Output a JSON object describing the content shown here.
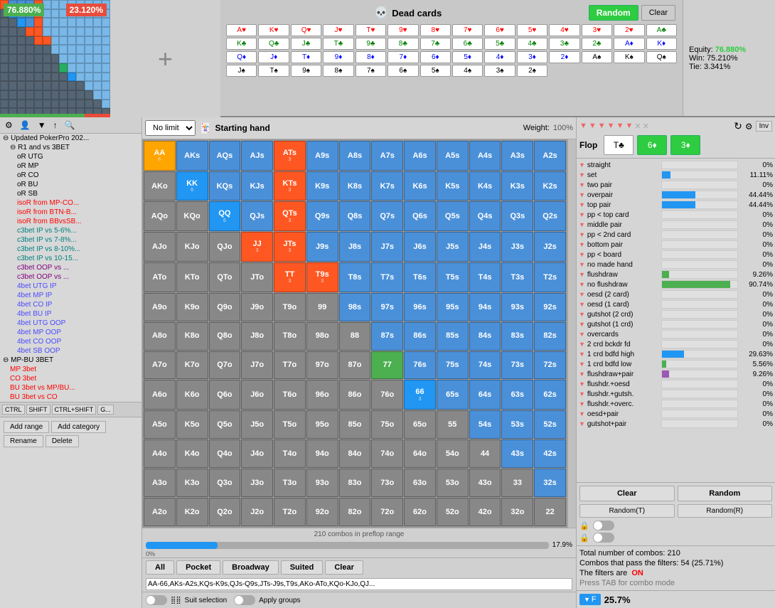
{
  "top": {
    "equity1": "76.880%",
    "equity2": "23.120%",
    "buttons": {
      "random": "Random",
      "clear": "Clear"
    },
    "equity": {
      "label": "Equity:",
      "value": "76.880%",
      "win_label": "Win:",
      "win_value": "75.210%",
      "tie_label": "Tie:",
      "tie_value": "3.341%"
    },
    "dead_cards_title": "Dead cards"
  },
  "sidebar": {
    "toolbar": {
      "icons": [
        "⚙",
        "👤",
        "▼",
        "↑",
        "🔍"
      ]
    },
    "tree": [
      {
        "label": "Updated PokerPro 202...",
        "level": 0,
        "type": "parent",
        "expanded": true
      },
      {
        "label": "R1 and vs 3BET",
        "level": 1,
        "type": "parent",
        "expanded": true
      },
      {
        "label": "oR UTG",
        "level": 2,
        "type": "leaf"
      },
      {
        "label": "oR MP",
        "level": 2,
        "type": "leaf"
      },
      {
        "label": "oR CO",
        "level": 2,
        "type": "leaf"
      },
      {
        "label": "oR BU",
        "level": 2,
        "type": "leaf"
      },
      {
        "label": "oR SB",
        "level": 2,
        "type": "leaf"
      },
      {
        "label": "isoR from MP-CO...",
        "level": 2,
        "type": "leaf",
        "color": "red"
      },
      {
        "label": "isoR from BTN-B...",
        "level": 2,
        "type": "leaf",
        "color": "red"
      },
      {
        "label": "isoR from BBvsSB...",
        "level": 2,
        "type": "leaf",
        "color": "red"
      },
      {
        "label": "c3bet IP vs 5-6%...",
        "level": 2,
        "type": "leaf",
        "color": "teal"
      },
      {
        "label": "c3bet IP vs 7-8%...",
        "level": 2,
        "type": "leaf",
        "color": "teal"
      },
      {
        "label": "c3bet IP vs 8-10%...",
        "level": 2,
        "type": "leaf",
        "color": "teal"
      },
      {
        "label": "c3bet IP vs 10-15...",
        "level": 2,
        "type": "leaf",
        "color": "teal"
      },
      {
        "label": "c3bet OOP vs ...",
        "level": 2,
        "type": "leaf",
        "color": "purple"
      },
      {
        "label": "c3bet OOP vs ...",
        "level": 2,
        "type": "leaf",
        "color": "purple"
      },
      {
        "label": "4bet UTG IP",
        "level": 2,
        "type": "leaf",
        "color": "blue"
      },
      {
        "label": "4bet MP IP",
        "level": 2,
        "type": "leaf",
        "color": "blue"
      },
      {
        "label": "4bet CO IP",
        "level": 2,
        "type": "leaf",
        "color": "blue"
      },
      {
        "label": "4bet BU IP",
        "level": 2,
        "type": "leaf",
        "color": "blue"
      },
      {
        "label": "4bet UTG OOP",
        "level": 2,
        "type": "leaf",
        "color": "blue"
      },
      {
        "label": "4bet MP OOP",
        "level": 2,
        "type": "leaf",
        "color": "blue"
      },
      {
        "label": "4bet CO OOP",
        "level": 2,
        "type": "leaf",
        "color": "blue"
      },
      {
        "label": "4bet SB OOP",
        "level": 2,
        "type": "leaf",
        "color": "blue"
      },
      {
        "label": "MP-BU 3BET",
        "level": 0,
        "type": "parent",
        "expanded": true
      },
      {
        "label": "MP 3bet",
        "level": 1,
        "type": "leaf",
        "color": "red"
      },
      {
        "label": "CO 3bet",
        "level": 1,
        "type": "leaf",
        "color": "red"
      },
      {
        "label": "BU 3bet vs MP/BU...",
        "level": 1,
        "type": "leaf",
        "color": "red"
      },
      {
        "label": "BU 3bet vs CO",
        "level": 1,
        "type": "leaf",
        "color": "red"
      }
    ],
    "bottom_buttons": [
      {
        "label": "Add range"
      },
      {
        "label": "Add category"
      },
      {
        "label": "Rename"
      },
      {
        "label": "Delete"
      }
    ],
    "keyboard_hints": [
      "CTRL",
      "SHIFT",
      "CTRL+SHIFT",
      "G..."
    ]
  },
  "center": {
    "toolbar": {
      "limit_options": [
        "No limit"
      ],
      "limit_selected": "No limit",
      "hand_label": "Starting hand",
      "weight_label": "Weight:",
      "weight_value": "100%"
    },
    "grid": {
      "headers": [
        "A",
        "K",
        "Q",
        "J",
        "T",
        "9",
        "8",
        "7",
        "6",
        "5",
        "4",
        "3",
        "2"
      ],
      "cells": [
        [
          "AA\n6",
          "AKs",
          "AQs",
          "AJs",
          "ATs\n3",
          "A9s",
          "A8s",
          "A7s",
          "A6s",
          "A5s",
          "A4s",
          "A3s",
          "A2s"
        ],
        [
          "AKo",
          "KK\n6",
          "KQs",
          "KJs",
          "KTs\n3",
          "K9s",
          "K8s",
          "K7s",
          "K6s",
          "K5s",
          "K4s",
          "K3s",
          "K2s"
        ],
        [
          "AQo",
          "KQo",
          "QQ\n6",
          "QJs",
          "QTs\n3",
          "Q9s",
          "Q8s",
          "Q7s",
          "Q6s",
          "Q5s",
          "Q4s",
          "Q3s",
          "Q2s"
        ],
        [
          "AJo",
          "KJo",
          "QJo",
          "JJ\n3",
          "JTs\n3",
          "J9s",
          "J8s",
          "J7s",
          "J6s",
          "J5s",
          "J4s",
          "J3s",
          "J2s"
        ],
        [
          "ATo",
          "KTo",
          "QTo",
          "JTo",
          "TT\n3",
          "T9s\n3",
          "T8s",
          "T7s",
          "T6s",
          "T5s",
          "T4s",
          "T3s",
          "T2s"
        ],
        [
          "A9o",
          "K9o",
          "Q9o",
          "J9o",
          "T9o",
          "99",
          "98s",
          "97s",
          "96s",
          "95s",
          "94s",
          "93s",
          "92s"
        ],
        [
          "A8o",
          "K8o",
          "Q8o",
          "J8o",
          "T8o",
          "98o",
          "88",
          "87s",
          "86s",
          "85s",
          "84s",
          "83s",
          "82s"
        ],
        [
          "A7o",
          "K7o",
          "Q7o",
          "J7o",
          "T7o",
          "97o",
          "87o",
          "77",
          "76s",
          "75s",
          "74s",
          "73s",
          "72s"
        ],
        [
          "A6o",
          "K6o",
          "Q6o",
          "J6o",
          "T6o",
          "96o",
          "86o",
          "76o",
          "66\n3",
          "65s",
          "64s",
          "63s",
          "62s"
        ],
        [
          "A5o",
          "K5o",
          "Q5o",
          "J5o",
          "T5o",
          "95o",
          "85o",
          "75o",
          "65o",
          "55",
          "54s",
          "53s",
          "52s"
        ],
        [
          "A4o",
          "K4o",
          "Q4o",
          "J4o",
          "T4o",
          "94o",
          "84o",
          "74o",
          "64o",
          "54o",
          "44",
          "43s",
          "42s"
        ],
        [
          "A3o",
          "K3o",
          "Q3o",
          "J3o",
          "T3o",
          "93o",
          "83o",
          "73o",
          "63o",
          "53o",
          "43o",
          "33",
          "32s"
        ],
        [
          "A2o",
          "K2o",
          "Q2o",
          "J2o",
          "T2o",
          "92o",
          "82o",
          "72o",
          "62o",
          "52o",
          "42o",
          "32o",
          "22"
        ]
      ],
      "cell_colors": {
        "0,0": "orange",
        "0,4": "orange",
        "1,1": "blue",
        "1,4": "orange",
        "2,2": "blue",
        "2,4": "orange",
        "3,3": "orange",
        "3,4": "orange",
        "4,4": "orange",
        "4,5": "orange",
        "5,5": "gray",
        "6,6": "gray",
        "7,7": "green",
        "8,8": "blue",
        "9,9": "gray",
        "10,10": "gray",
        "11,11": "gray",
        "12,12": "gray"
      },
      "combo_count": "210 combos in preflop range",
      "progress_pct": 17.9,
      "progress_label": "17.9%",
      "range_text": "AA-66,AKs-A2s,KQs-K9s,QJs-Q9s,JTs-J9s,T9s,AKo-ATo,KQo-KJo,QJ..."
    },
    "action_buttons": [
      "All",
      "Pocket",
      "Broadway",
      "Suited",
      "Clear"
    ],
    "suit_selection": "Suit selection",
    "apply_groups": "Apply groups"
  },
  "right": {
    "flop": {
      "title": "Flop",
      "cards": [
        {
          "label": "T♣",
          "suit": "clubs"
        },
        {
          "label": "6♦",
          "suit": "diamonds"
        },
        {
          "label": "3♦",
          "suit": "diamonds"
        }
      ],
      "filter_colors": [
        "red",
        "red",
        "red",
        "red",
        "red",
        "red",
        "gray",
        "gray"
      ],
      "inv_label": "Inv",
      "random_label": "Random",
      "clear_label": "Clear",
      "refresh_label": "↻"
    },
    "categories": [
      {
        "label": "straight",
        "pct": "0%",
        "bar": 0,
        "color": "green"
      },
      {
        "label": "set",
        "pct": "11.11%",
        "bar": 11.11,
        "color": "blue"
      },
      {
        "label": "two pair",
        "pct": "0%",
        "bar": 0,
        "color": "green"
      },
      {
        "label": "overpair",
        "pct": "44.44%",
        "bar": 44.44,
        "color": "blue"
      },
      {
        "label": "top pair",
        "pct": "44.44%",
        "bar": 44.44,
        "color": "blue"
      },
      {
        "label": "pp < top card",
        "pct": "0%",
        "bar": 0,
        "color": "green"
      },
      {
        "label": "middle pair",
        "pct": "0%",
        "bar": 0,
        "color": "green"
      },
      {
        "label": "pp < 2nd card",
        "pct": "0%",
        "bar": 0,
        "color": "green"
      },
      {
        "label": "bottom pair",
        "pct": "0%",
        "bar": 0,
        "color": "green"
      },
      {
        "label": "pp < board",
        "pct": "0%",
        "bar": 0,
        "color": "green"
      },
      {
        "label": "no made hand",
        "pct": "0%",
        "bar": 0,
        "color": "green"
      },
      {
        "label": "flushdraw",
        "pct": "9.26%",
        "bar": 9.26,
        "color": "green"
      },
      {
        "label": "no flushdraw",
        "pct": "90.74%",
        "bar": 90.74,
        "color": "green"
      },
      {
        "label": "oesd (2 card)",
        "pct": "0%",
        "bar": 0,
        "color": "green"
      },
      {
        "label": "oesd (1 card)",
        "pct": "0%",
        "bar": 0,
        "color": "green"
      },
      {
        "label": "gutshot (2 crd)",
        "pct": "0%",
        "bar": 0,
        "color": "green"
      },
      {
        "label": "gutshot (1 crd)",
        "pct": "0%",
        "bar": 0,
        "color": "green"
      },
      {
        "label": "overcards",
        "pct": "0%",
        "bar": 0,
        "color": "green"
      },
      {
        "label": "2 crd bckdr fd",
        "pct": "0%",
        "bar": 0,
        "color": "green"
      },
      {
        "label": "1 crd bdfd high",
        "pct": "29.63%",
        "bar": 29.63,
        "color": "blue"
      },
      {
        "label": "1 crd bdfd low",
        "pct": "5.56%",
        "bar": 5.56,
        "color": "green"
      },
      {
        "label": "flushdraw+pair",
        "pct": "9.26%",
        "bar": 9.26,
        "color": "purple"
      },
      {
        "label": "flushdr.+oesd",
        "pct": "0%",
        "bar": 0,
        "color": "green"
      },
      {
        "label": "flushdr.+gutsh.",
        "pct": "0%",
        "bar": 0,
        "color": "green"
      },
      {
        "label": "flushdr.+overc.",
        "pct": "0%",
        "bar": 0,
        "color": "green"
      },
      {
        "label": "oesd+pair",
        "pct": "0%",
        "bar": 0,
        "color": "green"
      },
      {
        "label": "gutshot+pair",
        "pct": "0%",
        "bar": 0,
        "color": "green"
      }
    ],
    "buttons": {
      "clear": "Clear",
      "random": "Random",
      "random_t": "Random(T)",
      "random_r": "Random(R)"
    },
    "stats": {
      "total_combos": "Total number of combos: 210",
      "passing_combos": "Combos that pass the filters: 54 (25.71%)",
      "filters_label": "The filters are",
      "filters_on": "ON",
      "tab_hint": "Press TAB for combo mode"
    },
    "filter_badge": {
      "f_label": "F",
      "f_pct": "25.7%"
    }
  },
  "cards": {
    "rows": [
      [
        "Ah",
        "Kh",
        "Qh",
        "Jh",
        "Th",
        "9h",
        "8h",
        "7h",
        "6h",
        "5h",
        "4h",
        "3h",
        "2h"
      ],
      [
        "Ac",
        "Kc",
        "Qc",
        "Jc",
        "Tc",
        "9c",
        "8c",
        "7c",
        "6c",
        "5c",
        "4c",
        "3c",
        "2c"
      ],
      [
        "Ad",
        "Kd",
        "Qd",
        "Jd",
        "Td",
        "9d",
        "8d",
        "7d",
        "6d",
        "5d",
        "4d",
        "3d",
        "2d"
      ],
      [
        "As",
        "Ks",
        "Qs",
        "Js",
        "Ts",
        "9s",
        "8s",
        "7s",
        "6s",
        "5s",
        "4s",
        "3s",
        "2s"
      ]
    ]
  }
}
